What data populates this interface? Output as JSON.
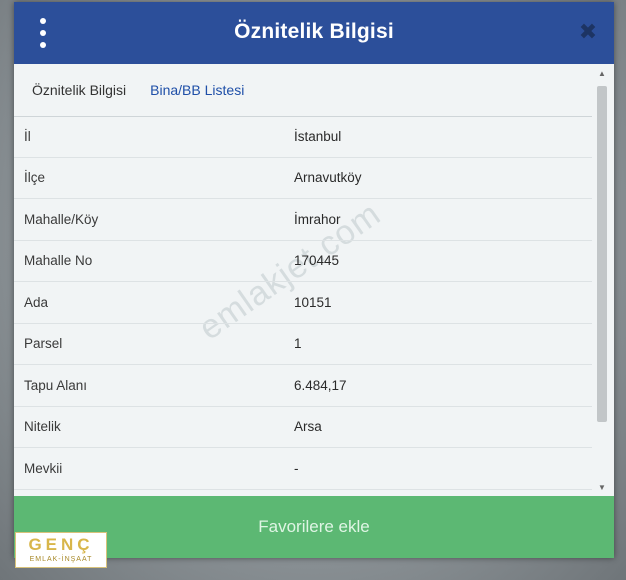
{
  "dialog": {
    "title": "Öznitelik Bilgisi",
    "close_glyph": "✖"
  },
  "tabs": [
    {
      "label": "Öznitelik Bilgisi",
      "active": false
    },
    {
      "label": "Bina/BB Listesi",
      "active": true
    }
  ],
  "rows": [
    {
      "label": "İl",
      "value": "İstanbul"
    },
    {
      "label": "İlçe",
      "value": "Arnavutköy"
    },
    {
      "label": "Mahalle/Köy",
      "value": "İmrahor"
    },
    {
      "label": "Mahalle No",
      "value": "170445"
    },
    {
      "label": "Ada",
      "value": "10151"
    },
    {
      "label": "Parsel",
      "value": "1"
    },
    {
      "label": "Tapu Alanı",
      "value": "6.484,17"
    },
    {
      "label": "Nitelik",
      "value": "Arsa"
    },
    {
      "label": "Mevkii",
      "value": "-"
    }
  ],
  "button": {
    "label": "Favorilere ekle"
  },
  "watermark": "emlakjet.com",
  "logo": {
    "main": "GENÇ",
    "sub": "EMLAK-İNŞAAT"
  },
  "colors": {
    "header": "#2c4f9a",
    "active_tab": "#1f4fa8",
    "button": "#5cb873"
  }
}
